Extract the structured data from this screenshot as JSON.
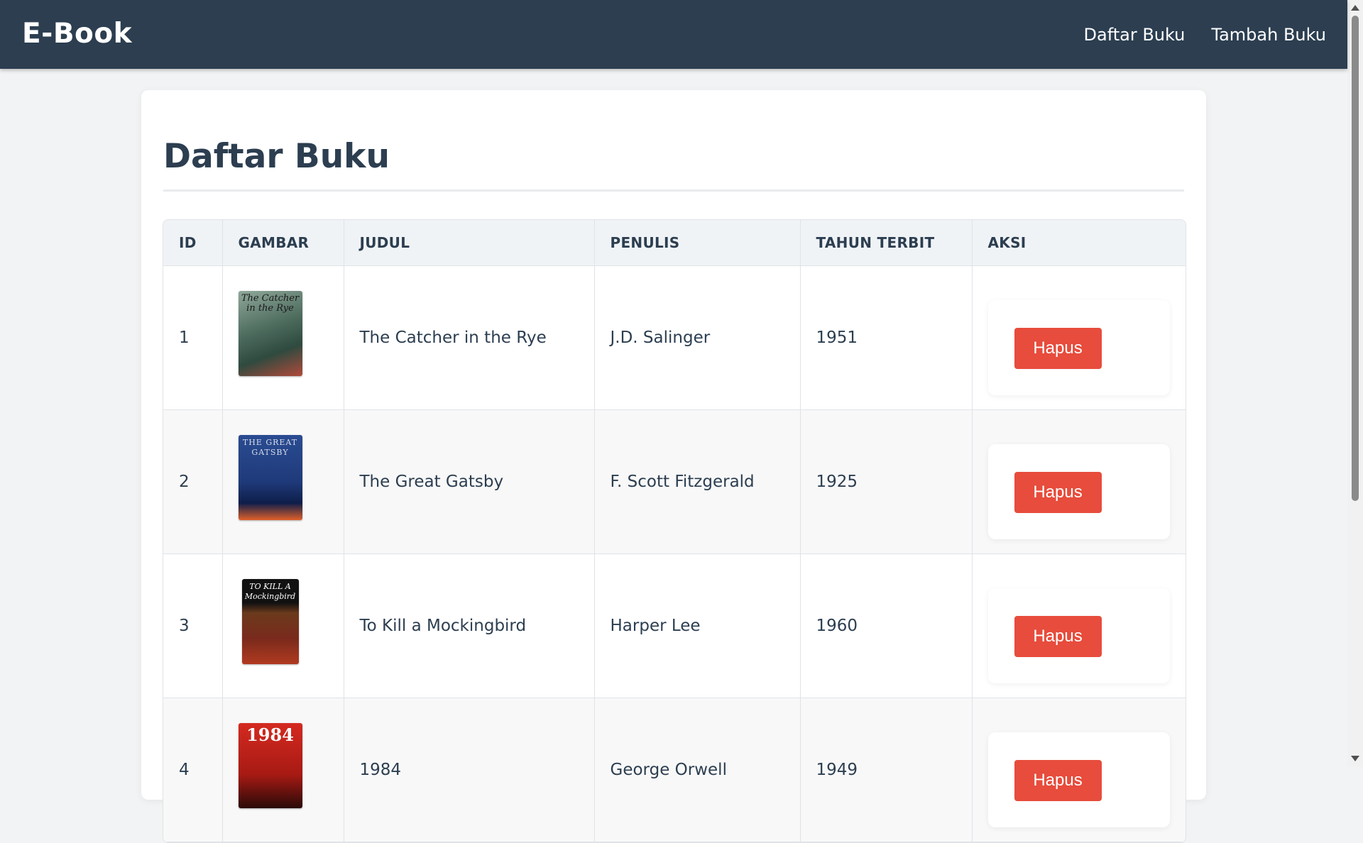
{
  "nav": {
    "brand": "E-Book",
    "links": [
      "Daftar Buku",
      "Tambah Buku"
    ]
  },
  "page": {
    "title": "Daftar Buku"
  },
  "table": {
    "headers": [
      "ID",
      "GAMBAR",
      "JUDUL",
      "PENULIS",
      "TAHUN TERBIT",
      "AKSI"
    ],
    "rows": [
      {
        "id": "1",
        "judul": "The Catcher in the Rye",
        "penulis": "J.D. Salinger",
        "tahun": "1951",
        "aksi": "Hapus",
        "cover_text": "The Catcher in the Rye",
        "cover_color": "#4b6a5c"
      },
      {
        "id": "2",
        "judul": "The Great Gatsby",
        "penulis": "F. Scott Fitzgerald",
        "tahun": "1925",
        "aksi": "Hapus",
        "cover_text": "THE GREAT GATSBY",
        "cover_color": "#1f3a7a"
      },
      {
        "id": "3",
        "judul": "To Kill a Mockingbird",
        "penulis": "Harper Lee",
        "tahun": "1960",
        "aksi": "Hapus",
        "cover_text": "TO KILL A Mockingbird",
        "cover_color": "#7a2a1c"
      },
      {
        "id": "4",
        "judul": "1984",
        "penulis": "George Orwell",
        "tahun": "1949",
        "aksi": "Hapus",
        "cover_text": "1984",
        "cover_color": "#d42a20"
      }
    ]
  },
  "colors": {
    "navbar": "#2c3e50",
    "danger": "#e74c3c",
    "header_bg": "#f0f3f6"
  }
}
